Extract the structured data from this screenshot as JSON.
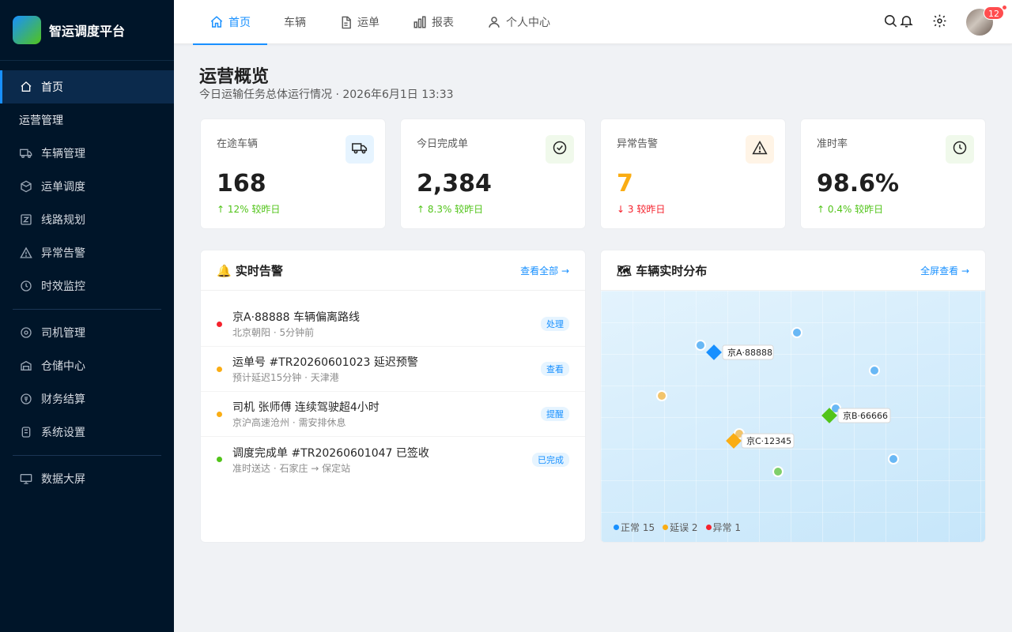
{
  "brand": {
    "logo_glyph": "",
    "name": "智运调度平台"
  },
  "sidebar": {
    "items": [
      {
        "label": "首页",
        "icon": "home-icon",
        "active": true
      }
    ],
    "section_label": "运营管理",
    "group1": [
      {
        "label": "车辆管理",
        "icon": "truck-icon"
      },
      {
        "label": "运单调度",
        "icon": "box-icon"
      },
      {
        "label": "线路规划",
        "icon": "route-icon"
      },
      {
        "label": "异常告警",
        "icon": "warning-icon"
      },
      {
        "label": "时效监控",
        "icon": "clock-icon"
      }
    ],
    "group2": [
      {
        "label": "司机管理",
        "icon": "driver-icon"
      },
      {
        "label": "仓储中心",
        "icon": "warehouse-icon"
      },
      {
        "label": "财务结算",
        "icon": "wallet-icon"
      },
      {
        "label": "系统设置",
        "icon": "settings-icon"
      }
    ],
    "group3": [
      {
        "label": "数据大屏",
        "icon": "monitor-icon"
      }
    ]
  },
  "topnav": {
    "tabs": [
      {
        "label": "首页",
        "icon": "home-icon",
        "active": true
      },
      {
        "label": "车辆",
        "icon": "",
        "active": false
      },
      {
        "label": "运单",
        "icon": "document-icon",
        "active": false
      },
      {
        "label": "报表",
        "icon": "bar-chart-icon",
        "active": false
      },
      {
        "label": "个人中心",
        "icon": "user-icon",
        "active": false
      }
    ],
    "avatar_badge": "12"
  },
  "page": {
    "title": "运营概览",
    "subtitle": "今日运输任务总体运行情况 · 2026年6月1日 13:33"
  },
  "stats": [
    {
      "label": "在途车辆",
      "value": "168",
      "trend": "↑ 12% 较昨日",
      "trend_color": "#52c41a",
      "value_color": "#1f1f1f",
      "icon": "truck-icon",
      "icon_bg": "#e6f4ff",
      "icon_color": "#262626"
    },
    {
      "label": "今日完成单",
      "value": "2,384",
      "trend": "↑ 8.3% 较昨日",
      "trend_color": "#52c41a",
      "value_color": "#1f1f1f",
      "icon": "check-circle-icon",
      "icon_bg": "#f0f9eb",
      "icon_color": "#262626"
    },
    {
      "label": "异常告警",
      "value": "7",
      "trend": "↓ 3 较昨日",
      "trend_color": "#f5222d",
      "value_color": "#faad14",
      "icon": "warning-icon",
      "icon_bg": "#fff4e6",
      "icon_color": "#262626"
    },
    {
      "label": "准时率",
      "value": "98.6%",
      "trend": "↑ 0.4% 较昨日",
      "trend_color": "#52c41a",
      "value_color": "#1f1f1f",
      "icon": "clock-icon",
      "icon_bg": "#f0f9eb",
      "icon_color": "#262626"
    }
  ],
  "alerts_panel": {
    "title": "🔔 实时告警",
    "link": "查看全部 →",
    "items": [
      {
        "title": "京A·88888 车辆偏离路线",
        "meta": "北京朝阳 · 5分钟前",
        "tag": "处理",
        "color": "#f5222d"
      },
      {
        "title": "运单号 #TR20260601023 延迟预警",
        "meta": "预计延迟15分钟 · 天津港",
        "tag": "查看",
        "color": "#faad14"
      },
      {
        "title": "司机 张师傅 连续驾驶超4小时",
        "meta": "京沪高速沧州 · 需安排休息",
        "tag": "提醒",
        "color": "#faad14"
      },
      {
        "title": "调度完成单 #TR20260601047 已签收",
        "meta": "准时送达 · 石家庄 → 保定站",
        "tag": "已完成",
        "color": "#52c41a"
      }
    ]
  },
  "map_panel": {
    "title": "🗺 车辆实时分布",
    "link": "全屏查看 →",
    "vehicles": [
      {
        "label": "京A·88888",
        "color": "#1890ff"
      },
      {
        "label": "京B·66666",
        "color": "#52c41a"
      },
      {
        "label": "京C·12345",
        "color": "#faad14"
      }
    ],
    "legend": [
      {
        "label": "正常 15",
        "color": "#1890ff"
      },
      {
        "label": "延误 2",
        "color": "#faad14"
      },
      {
        "label": "异常 1",
        "color": "#f5222d"
      }
    ]
  }
}
